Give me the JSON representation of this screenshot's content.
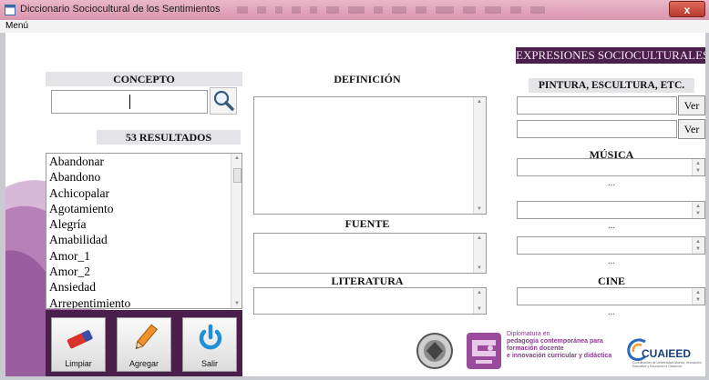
{
  "window": {
    "title": "Diccionario Sociocultural de los Sentimientos",
    "close_label": "x"
  },
  "menu": {
    "label": "Menú"
  },
  "concepto": {
    "header": "CONCEPTO",
    "input_value": "",
    "results_header": "53 RESULTADOS",
    "results": [
      "Abandonar",
      "Abandono",
      "Achicopalar",
      "Agotamiento",
      "Alegría",
      "Amabilidad",
      "Amor_1",
      "Amor_2",
      "Ansiedad",
      "Arrepentimiento"
    ]
  },
  "definicion": {
    "header": "DEFINICIÓN"
  },
  "fuente": {
    "header": "FUENTE"
  },
  "literatura": {
    "header": "LITERATURA"
  },
  "expresiones": {
    "banner": "EXPRESIONES SOCIOCULTURALES",
    "pintura_header": "PINTURA, ESCULTURA, ETC.",
    "ver_label": "Ver",
    "musica_header": "MÚSICA",
    "cine_header": "CINE",
    "dots": "..."
  },
  "actions": {
    "limpiar": "Limpiar",
    "agregar": "Agregar",
    "salir": "Salir"
  },
  "logos": {
    "diplomado": [
      "Diplomatura en",
      "pedagogía contemporánea para",
      "formación docente",
      "e innovación curricular y didáctica"
    ],
    "cuaieed": "CUAIEED",
    "cuaieed_sub": "Coordinación de Universidad Abierta, Innovación Educativa y Educación a Distancia"
  },
  "colors": {
    "accent": "#4a1f4c",
    "title_gradient": "#d995ae",
    "close": "#c0392b"
  }
}
